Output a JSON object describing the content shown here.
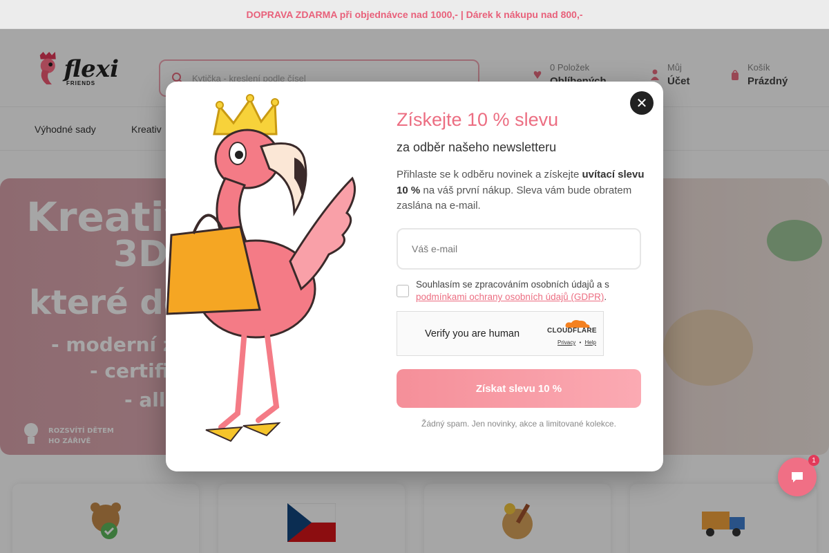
{
  "promo": {
    "text": "DOPRAVA ZDARMA při objednávce nad 1000,- | Dárek k nákupu nad 800,-"
  },
  "header": {
    "logo_text": "flexi",
    "logo_sub": "FRIENDS",
    "search_placeholder": "Kytička - kreslení podle čísel",
    "wishlist": {
      "line1": "0 Položek",
      "line2": "Oblíbených"
    },
    "account": {
      "line1": "Můj",
      "line2": "Účet"
    },
    "cart": {
      "line1": "Košík",
      "line2": "Prázdný"
    }
  },
  "nav": {
    "items": [
      "Výhodné sady",
      "Kreativ"
    ]
  },
  "hero": {
    "line1": "Kreativ",
    "line2": "3D",
    "line3": "které dě",
    "line4": "- moderní z",
    "line5": "- certifi",
    "line6": "- all",
    "badge1_line1": "ROZSVÍTÍ DĚTEM",
    "badge1_line2": "HO ZÁŘIVĚ"
  },
  "chat": {
    "badge": "1"
  },
  "modal": {
    "title": "Získejte 10 % slevu",
    "subtitle": "za odběr našeho newsletteru",
    "desc_pre": "Přihlaste se k odběru novinek a získejte ",
    "desc_bold": "uvítací slevu 10 %",
    "desc_post": " na váš první nákup. Sleva vám bude obratem zaslána na e-mail.",
    "email_placeholder": "Váš e-mail",
    "consent_pre": "Souhlasím se zpracováním osobních údajů a s ",
    "consent_link": "podmínkami ochrany osobních údajů (GDPR)",
    "consent_post": ".",
    "captcha_text": "Verify you are human",
    "captcha_brand": "CLOUDFLARE",
    "captcha_privacy": "Privacy",
    "captcha_sep": "•",
    "captcha_help": "Help",
    "cta": "Získat slevu 10 %",
    "footnote": "Žádný spam. Jen novinky, akce a limitované kolekce.",
    "close_symbol": "✕"
  },
  "colors": {
    "accent": "#ec6e82",
    "promo_text": "#e8607a",
    "cta_start": "#f58f99",
    "cta_end": "#fbaab3"
  }
}
